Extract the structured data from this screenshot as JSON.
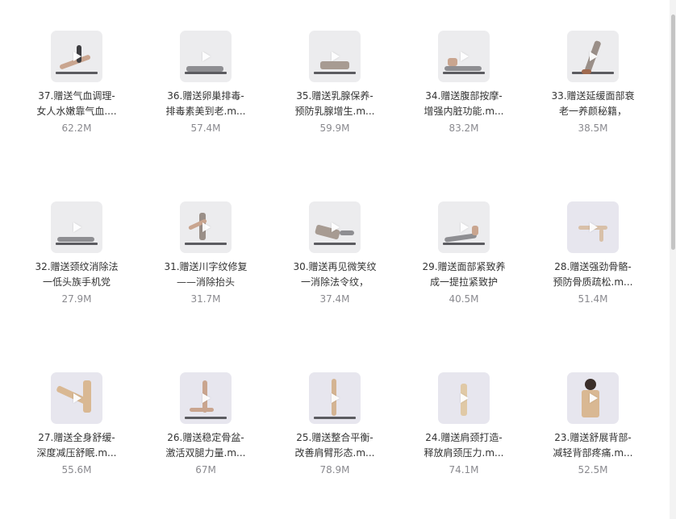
{
  "files": [
    {
      "line1": "37.赠送气血调理-",
      "line2": "女人水嫩靠气血....",
      "size": "62.2M"
    },
    {
      "line1": "36.赠送卵巢排毒-",
      "line2": "排毒素美到老.m...",
      "size": "57.4M"
    },
    {
      "line1": "35.赠送乳腺保养-",
      "line2": "预防乳腺增生.m...",
      "size": "59.9M"
    },
    {
      "line1": "34.赠送腹部按摩-",
      "line2": "增强内脏功能.m...",
      "size": "83.2M"
    },
    {
      "line1": "33.赠送延缓面部衰",
      "line2": "老一养颜秘籍，",
      "size": "38.5M"
    },
    {
      "line1": "32.赠送颈纹消除法",
      "line2": "一低头族手机党",
      "size": "27.9M"
    },
    {
      "line1": "31.赠送川字纹修复",
      "line2": "——消除抬头",
      "size": "31.7M"
    },
    {
      "line1": "30.赠送再见微笑纹",
      "line2": "一消除法令纹，",
      "size": "37.4M"
    },
    {
      "line1": "29.赠送面部紧致养",
      "line2": "成一提拉紧致护",
      "size": "40.5M"
    },
    {
      "line1": "28.赠送强劲骨骼-",
      "line2": "预防骨质疏松.m...",
      "size": "51.4M"
    },
    {
      "line1": "27.赠送全身舒缓-",
      "line2": "深度减压舒眠.m...",
      "size": "55.6M"
    },
    {
      "line1": "26.赠送稳定骨盆-",
      "line2": "激活双腿力量.m...",
      "size": "67M"
    },
    {
      "line1": "25.赠送整合平衡-",
      "line2": "改善肩臂形态.m...",
      "size": "78.9M"
    },
    {
      "line1": "24.赠送肩颈打造-",
      "line2": "释放肩颈压力.m...",
      "size": "74.1M"
    },
    {
      "line1": "23.赠送舒展背部-",
      "line2": "减轻背部疼痛.m...",
      "size": "52.5M"
    }
  ],
  "icons": {
    "thumbnail_overlay": "play-icon"
  }
}
